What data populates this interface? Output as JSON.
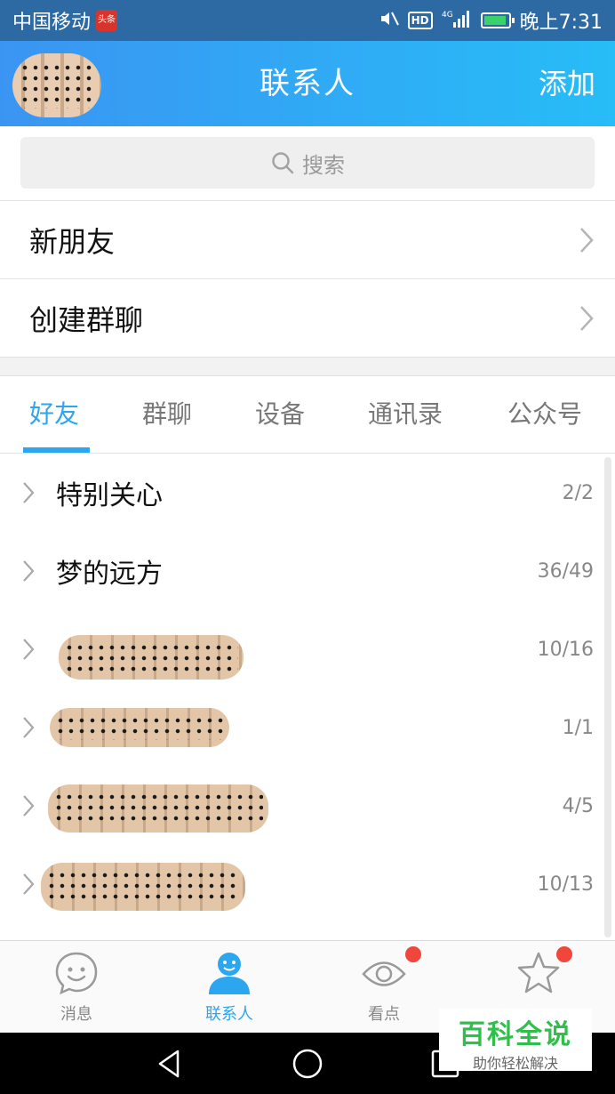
{
  "statusbar": {
    "carrier": "中国移动",
    "badge": "头条",
    "network": "4G",
    "hd": "HD",
    "time": "晚上7:31"
  },
  "header": {
    "title": "联系人",
    "add_label": "添加",
    "gradient_from": "#3a95f2",
    "gradient_to": "#27bdf7"
  },
  "search": {
    "placeholder": "搜索"
  },
  "quick_rows": [
    {
      "label": "新朋友"
    },
    {
      "label": "创建群聊"
    }
  ],
  "tabs": [
    {
      "label": "好友",
      "active": true
    },
    {
      "label": "群聊",
      "active": false
    },
    {
      "label": "设备",
      "active": false
    },
    {
      "label": "通讯录",
      "active": false
    },
    {
      "label": "公众号",
      "active": false
    }
  ],
  "groups": [
    {
      "name": "特别关心",
      "count": "2/2"
    },
    {
      "name": "梦的远方",
      "count": "36/49"
    },
    {
      "name": "",
      "count": "10/16",
      "redacted": true
    },
    {
      "name": "",
      "count": "1/1",
      "redacted": true
    },
    {
      "name": "",
      "count": "4/5",
      "redacted": true
    },
    {
      "name": "",
      "count": "10/13",
      "redacted": true
    }
  ],
  "bottom_nav": [
    {
      "label": "消息",
      "icon": "smile-chat-icon",
      "active": false,
      "badge": false
    },
    {
      "label": "联系人",
      "icon": "person-icon",
      "active": true,
      "badge": false
    },
    {
      "label": "看点",
      "icon": "eye-icon",
      "active": false,
      "badge": true
    },
    {
      "label": "",
      "icon": "star-icon",
      "active": false,
      "badge": true
    }
  ],
  "watermark": {
    "title": "百科全说",
    "subtitle": "助你轻松解决"
  },
  "colors": {
    "accent": "#2da6f0",
    "badge_red": "#f0463c"
  }
}
